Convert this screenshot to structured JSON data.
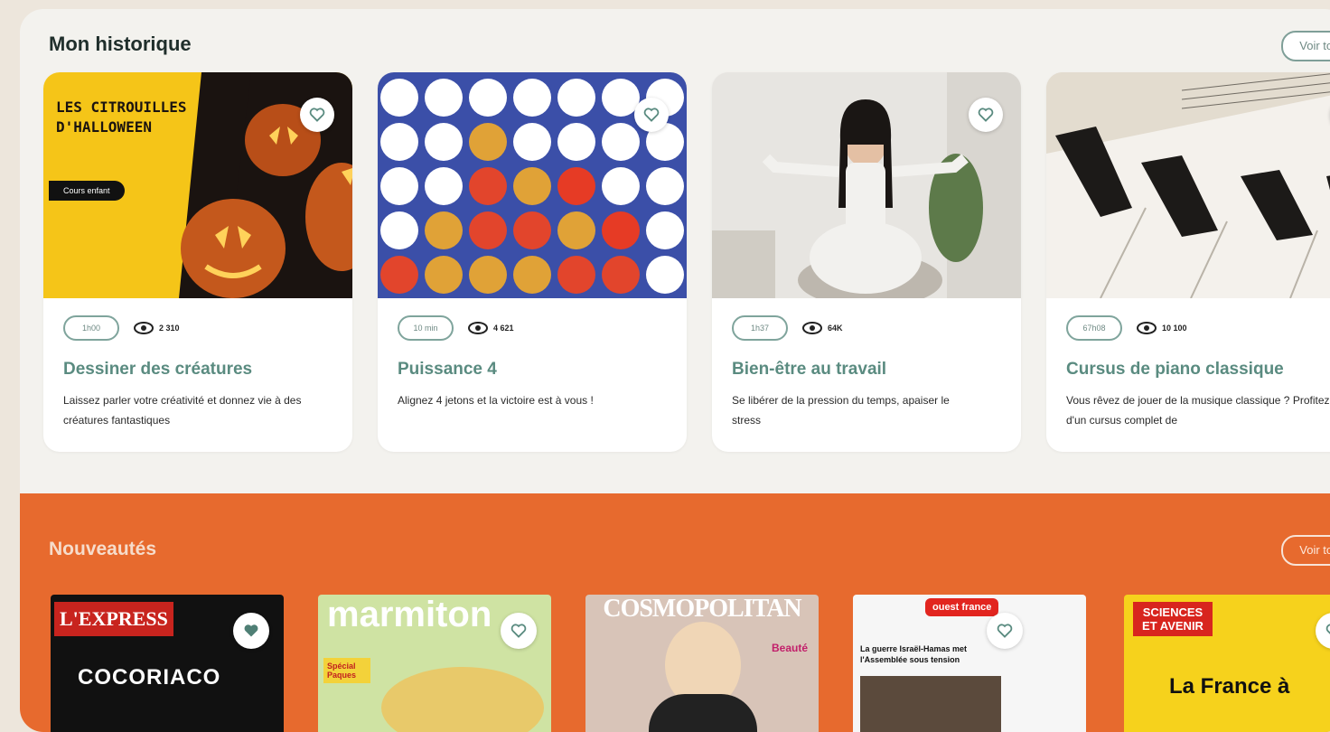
{
  "history": {
    "title": "Mon historique",
    "see_all": "Voir tout",
    "cards": [
      {
        "thumb_label": "Les citrouilles d'Halloween",
        "thumb_badge": "Cours enfant",
        "tag": "1h00",
        "views": "2 310",
        "title": "Dessiner des créatures",
        "desc": "Laissez parler votre créativité et donnez vie à des créatures fantastiques"
      },
      {
        "tag": "10 min",
        "views": "4 621",
        "title": "Puissance 4",
        "desc": "Alignez 4 jetons et la victoire est à vous !"
      },
      {
        "tag": "1h37",
        "views": "64K",
        "title": "Bien-être au travail",
        "desc": "Se libérer de la pression du temps, apaiser le stress"
      },
      {
        "tag": "67h08",
        "views": "10 100",
        "title": "Cursus de piano classique",
        "desc": "Vous rêvez de jouer de la musique classique ? Profitez d'un cursus complet de"
      }
    ]
  },
  "news": {
    "title": "Nouveautés",
    "see_all": "Voir tout",
    "magazines": [
      {
        "brand": "L'EXPRESS",
        "headline": "COCORIACO"
      },
      {
        "brand": "marmiton",
        "headline": "Spécial Paques"
      },
      {
        "brand": "COSMOPOLITAN",
        "headline": "Beauté"
      },
      {
        "brand": "ouest france",
        "headline": "La guerre Israël-Hamas met l'Assemblée sous tension"
      },
      {
        "brand": "SCIENCES ET AVENIR",
        "headline": "La France à"
      }
    ]
  },
  "colors": {
    "accent_teal": "#5a8b80",
    "orange": "#e76a2e"
  }
}
